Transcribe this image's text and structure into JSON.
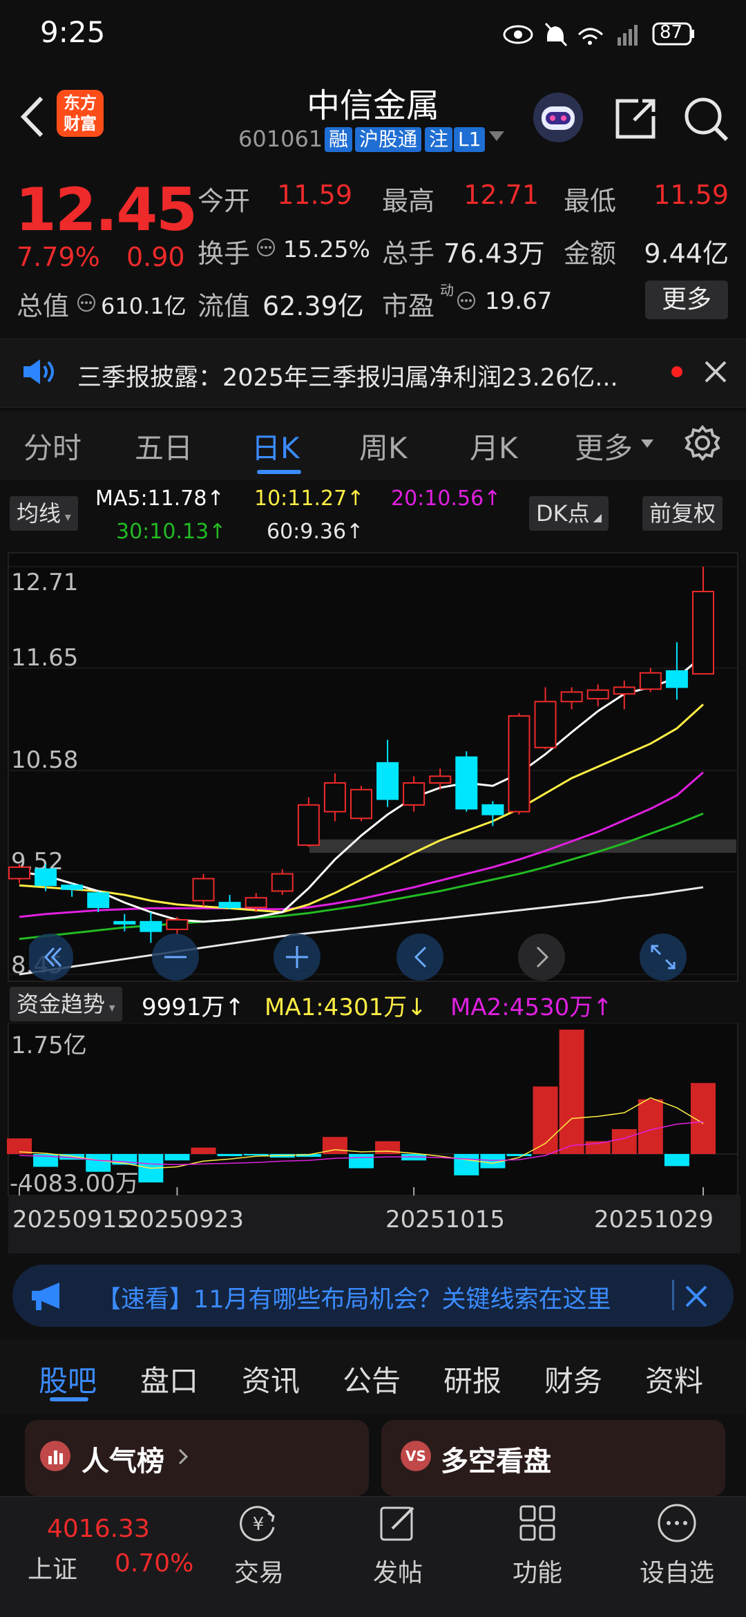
{
  "status": {
    "time": "9:25",
    "battery": "87"
  },
  "header": {
    "logo": [
      "东方",
      "财富"
    ],
    "name": "中信金属",
    "code": "601061",
    "tags": [
      "融",
      "沪股通",
      "注",
      "L1"
    ]
  },
  "quote": {
    "price": "12.45",
    "pct": "7.79%",
    "change": "0.90",
    "total_value_label": "总值",
    "total_value": "610.1亿",
    "fields": {
      "open_label": "今开",
      "open": "11.59",
      "high_label": "最高",
      "high": "12.71",
      "low_label": "最低",
      "low": "11.59",
      "turnover_label": "换手",
      "turnover": "15.25%",
      "volume_label": "总手",
      "volume": "76.43万",
      "amount_label": "金额",
      "amount": "9.44亿",
      "float_label": "流值",
      "float_value": "62.39亿",
      "pe_label": "市盈",
      "pe_sup": "动",
      "pe": "19.67"
    },
    "more_label": "更多"
  },
  "notice": {
    "text": "三季报披露：2025年三季报归属净利润23.26亿..."
  },
  "period_tabs": [
    {
      "label": "分时",
      "active": false
    },
    {
      "label": "五日",
      "active": false
    },
    {
      "label": "日K",
      "active": true
    },
    {
      "label": "周K",
      "active": false
    },
    {
      "label": "月K",
      "active": false
    },
    {
      "label": "更多",
      "active": false
    }
  ],
  "ma_legend": {
    "selector": "均线",
    "ma5": "MA5:11.78↑",
    "ma10": "10:11.27↑",
    "ma20": "20:10.56↑",
    "ma30": "30:10.13↑",
    "ma60": "60:9.36↑",
    "dk": "DK点",
    "adjust": "前复权"
  },
  "chart_data": {
    "type": "candlestick",
    "y_ticks": [
      "12.71",
      "11.65",
      "10.58",
      "9.52",
      "8.45"
    ],
    "ylim": [
      8.45,
      12.71
    ],
    "candles": [
      {
        "o": 9.45,
        "c": 9.57,
        "h": 9.6,
        "l": 9.4
      },
      {
        "o": 9.55,
        "c": 9.38,
        "h": 9.6,
        "l": 9.32
      },
      {
        "o": 9.38,
        "c": 9.34,
        "h": 9.4,
        "l": 9.26
      },
      {
        "o": 9.3,
        "c": 9.15,
        "h": 9.32,
        "l": 9.1
      },
      {
        "o": 9.0,
        "c": 8.99,
        "h": 9.08,
        "l": 8.9
      },
      {
        "o": 9.0,
        "c": 8.9,
        "h": 9.1,
        "l": 8.78
      },
      {
        "o": 8.92,
        "c": 9.02,
        "h": 9.05,
        "l": 8.86
      },
      {
        "o": 9.22,
        "c": 9.45,
        "h": 9.5,
        "l": 9.16
      },
      {
        "o": 9.2,
        "c": 9.15,
        "h": 9.28,
        "l": 9.13
      },
      {
        "o": 9.15,
        "c": 9.25,
        "h": 9.3,
        "l": 9.1
      },
      {
        "o": 9.32,
        "c": 9.5,
        "h": 9.55,
        "l": 9.28
      },
      {
        "o": 9.8,
        "c": 10.22,
        "h": 10.3,
        "l": 9.78
      },
      {
        "o": 10.15,
        "c": 10.45,
        "h": 10.55,
        "l": 10.05
      },
      {
        "o": 10.08,
        "c": 10.38,
        "h": 10.42,
        "l": 10.05
      },
      {
        "o": 10.66,
        "c": 10.28,
        "h": 10.9,
        "l": 10.2
      },
      {
        "o": 10.22,
        "c": 10.45,
        "h": 10.52,
        "l": 10.15
      },
      {
        "o": 10.45,
        "c": 10.52,
        "h": 10.6,
        "l": 10.38
      },
      {
        "o": 10.72,
        "c": 10.18,
        "h": 10.78,
        "l": 10.15
      },
      {
        "o": 10.22,
        "c": 10.12,
        "h": 10.26,
        "l": 10.0
      },
      {
        "o": 10.15,
        "c": 11.15,
        "h": 11.18,
        "l": 10.12
      },
      {
        "o": 10.82,
        "c": 11.3,
        "h": 11.45,
        "l": 10.8
      },
      {
        "o": 11.3,
        "c": 11.4,
        "h": 11.45,
        "l": 11.22
      },
      {
        "o": 11.33,
        "c": 11.42,
        "h": 11.48,
        "l": 11.25
      },
      {
        "o": 11.38,
        "c": 11.45,
        "h": 11.52,
        "l": 11.22
      },
      {
        "o": 11.43,
        "c": 11.6,
        "h": 11.65,
        "l": 11.4
      },
      {
        "o": 11.62,
        "c": 11.45,
        "h": 11.92,
        "l": 11.32
      },
      {
        "o": 11.59,
        "c": 12.45,
        "h": 12.71,
        "l": 11.59
      }
    ],
    "ma5": [
      9.52,
      9.48,
      9.4,
      9.32,
      9.2,
      9.1,
      9.02,
      9.0,
      9.02,
      9.05,
      9.1,
      9.35,
      9.65,
      9.9,
      10.12,
      10.3,
      10.4,
      10.45,
      10.42,
      10.55,
      10.75,
      10.98,
      11.2,
      11.38,
      11.45,
      11.55,
      11.78
    ],
    "ma10": [
      9.38,
      9.36,
      9.34,
      9.32,
      9.28,
      9.22,
      9.18,
      9.16,
      9.14,
      9.12,
      9.1,
      9.18,
      9.3,
      9.44,
      9.58,
      9.72,
      9.85,
      9.95,
      10.05,
      10.18,
      10.34,
      10.5,
      10.62,
      10.74,
      10.86,
      11.02,
      11.27
    ],
    "ma20": [
      9.05,
      9.08,
      9.1,
      9.12,
      9.13,
      9.14,
      9.14,
      9.14,
      9.14,
      9.13,
      9.13,
      9.15,
      9.19,
      9.24,
      9.3,
      9.36,
      9.43,
      9.5,
      9.57,
      9.65,
      9.74,
      9.84,
      9.94,
      10.06,
      10.18,
      10.32,
      10.56
    ],
    "ma30": [
      8.82,
      8.85,
      8.88,
      8.91,
      8.94,
      8.96,
      8.98,
      9.0,
      9.02,
      9.04,
      9.06,
      9.09,
      9.13,
      9.17,
      9.22,
      9.27,
      9.32,
      9.38,
      9.44,
      9.5,
      9.57,
      9.65,
      9.73,
      9.82,
      9.92,
      10.02,
      10.13
    ],
    "ma60": [
      8.45,
      8.49,
      8.53,
      8.57,
      8.61,
      8.65,
      8.69,
      8.73,
      8.77,
      8.81,
      8.85,
      8.88,
      8.91,
      8.94,
      8.97,
      9.0,
      9.03,
      9.06,
      9.09,
      9.12,
      9.15,
      9.18,
      9.21,
      9.25,
      9.28,
      9.32,
      9.36
    ],
    "volume": {
      "label": "资金趋势",
      "value": "9991万↑",
      "ma1": "MA1:4301万↓",
      "ma2": "MA2:4530万↑",
      "y_ticks": [
        "1.75亿",
        "-4083.00万"
      ],
      "bars_wan": [
        2200,
        -1800,
        -800,
        -2500,
        -1500,
        -4000,
        -900,
        900,
        -300,
        -200,
        -500,
        -400,
        2400,
        -2000,
        1800,
        -900,
        0,
        -3000,
        -2000,
        -300,
        9500,
        17500,
        1800,
        3500,
        7700,
        -1700,
        9991
      ],
      "ma1_wan": [
        300,
        100,
        -300,
        -900,
        -1300,
        -2000,
        -1800,
        -1000,
        -700,
        -300,
        -200,
        -100,
        600,
        300,
        400,
        100,
        -300,
        -800,
        -1300,
        -500,
        1500,
        5000,
        5300,
        5800,
        7900,
        6500,
        4301
      ],
      "ma2_wan": [
        -200,
        -300,
        -500,
        -900,
        -1100,
        -1400,
        -1500,
        -1400,
        -1300,
        -1200,
        -1000,
        -900,
        -600,
        -500,
        -400,
        -400,
        -500,
        -700,
        -900,
        -800,
        -200,
        1200,
        1500,
        2200,
        3400,
        4200,
        4530
      ]
    },
    "x_dates": [
      "20250915",
      "20250923",
      "20251015",
      "20251029"
    ]
  },
  "promo": {
    "text": "【速看】11月有哪些布局机会？关键线索在这里"
  },
  "bottom_tabs": [
    "股吧",
    "盘口",
    "资讯",
    "公告",
    "研报",
    "财务",
    "资料"
  ],
  "cards": [
    "人气榜",
    "多空看盘"
  ],
  "footer": {
    "index_value": "4016.33",
    "index_name": "上证",
    "index_pct": "0.70%",
    "nav": [
      "交易",
      "发帖",
      "功能",
      "设自选"
    ]
  },
  "colors": {
    "up": "#ef2a2a",
    "down": "#00e6ff",
    "ma5": "#ffffff",
    "ma10": "#ffee44",
    "ma20": "#e020e0",
    "ma30": "#22bb22",
    "ma60": "#e8e8e8",
    "accent": "#3b8cff"
  }
}
